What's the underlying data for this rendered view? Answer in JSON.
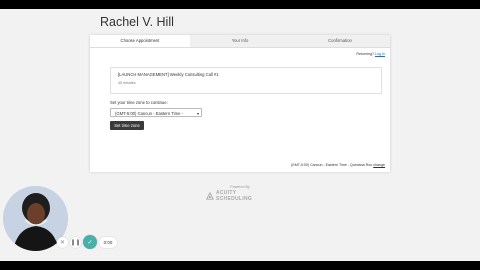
{
  "page": {
    "title": "Rachel V. Hill"
  },
  "tabs": [
    {
      "label": "Choose Appointment"
    },
    {
      "label": "Your Info"
    },
    {
      "label": "Confirmation"
    }
  ],
  "returning": {
    "text": "Returning?",
    "link": "Log In"
  },
  "appointment": {
    "title": "[LAUNCH MANAGEMENT] Weekly Consulting Call #1",
    "duration": "45 minutes"
  },
  "timezone": {
    "label": "Set your time zone to continue:",
    "selected": "(GMT-5:00) Cancun - Eastern Time -",
    "button": "Set time zone",
    "footer": "(GMT-5:00) Cancun - Eastern Time - Quintana Roo",
    "footer_link": "change"
  },
  "branding": {
    "powered": "Powered By",
    "name": "ACUITY SCHEDULING"
  },
  "recorder": {
    "time": "0:00"
  },
  "icons": [
    "chevron-down-icon",
    "acuity-logo-icon",
    "close-icon",
    "pause-icon",
    "check-icon"
  ],
  "colors": {
    "accent": "#48b0a8",
    "button": "#3a3a3a",
    "link": "#2a6db5"
  }
}
